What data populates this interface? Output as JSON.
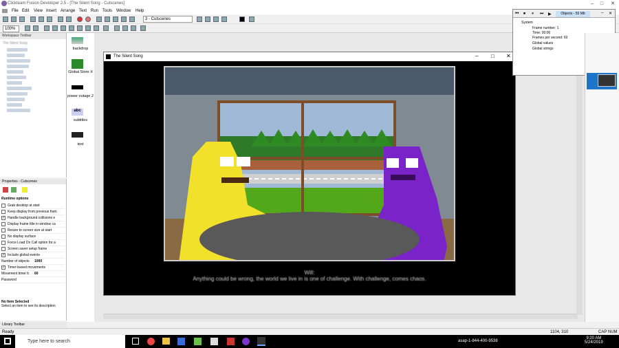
{
  "app": {
    "title": "Clickteam Fusion Developer 2.5 - [The Silent Song - Cutscenes]"
  },
  "menu": [
    "File",
    "Edit",
    "View",
    "Insert",
    "Arrange",
    "Text",
    "Run",
    "Tools",
    "Window",
    "Help"
  ],
  "toolbar": {
    "frame_select": "3 - Cutscenes",
    "zoom": "100%"
  },
  "workspace": {
    "header": "Workspace Toolbar",
    "root": "The Silent Song"
  },
  "objects": [
    {
      "label": "backdrop"
    },
    {
      "label": "Global Store X"
    },
    {
      "label": "power outage 2"
    },
    {
      "label": "subtitles"
    },
    {
      "label": "text"
    }
  ],
  "properties": {
    "header": "Properties - Cutscenes",
    "section": "Runtime options",
    "rows": [
      {
        "label": "Grab desktop at start",
        "checked": false
      },
      {
        "label": "Keep display from previous fram",
        "checked": false
      },
      {
        "label": "Handle background collisions e",
        "checked": true
      },
      {
        "label": "Display frame title in window ca",
        "checked": false
      },
      {
        "label": "Resize to screen size at start",
        "checked": false
      },
      {
        "label": "No display surface",
        "checked": false
      },
      {
        "label": "Force Load On Call option for a",
        "checked": false
      },
      {
        "label": "Screen saver setup frame",
        "checked": false
      },
      {
        "label": "Include global events",
        "checked": true
      }
    ],
    "num_objects_label": "Number of objects",
    "num_objects_value": "1000",
    "timer_label": "Timer-based movements",
    "movement_timer_label": "Movement timer b",
    "movement_timer_value": "60",
    "password_label": "Password",
    "no_item": "No Item Selected",
    "no_item_desc": "Select an item to see its description"
  },
  "game_window": {
    "title": "The Silent Song"
  },
  "subtitle": {
    "speaker": "Will:",
    "line": "Anything could be wrong, the world we live in is one of challenge. With challenge, comes chaos."
  },
  "debugger": {
    "objects_label": "Objects - 55 Mb",
    "tree": [
      "System",
      "Frame number: 1",
      "Time: 00:06",
      "Frames per second: 60",
      "Global values",
      "Global strings"
    ]
  },
  "library": {
    "header": "Library Toolbar"
  },
  "status": {
    "left": "Ready",
    "coords": "1104, 310",
    "caps": "CAP NUM"
  },
  "taskbar": {
    "search_placeholder": "Type here to search",
    "phone": "asap-1-844-400-9538",
    "time": "9:20 AM",
    "date": "5/24/2019"
  },
  "colors": {
    "accent": "#1e74c6",
    "yellow_char": "#f1e12a",
    "purple_char": "#7a23c8"
  }
}
